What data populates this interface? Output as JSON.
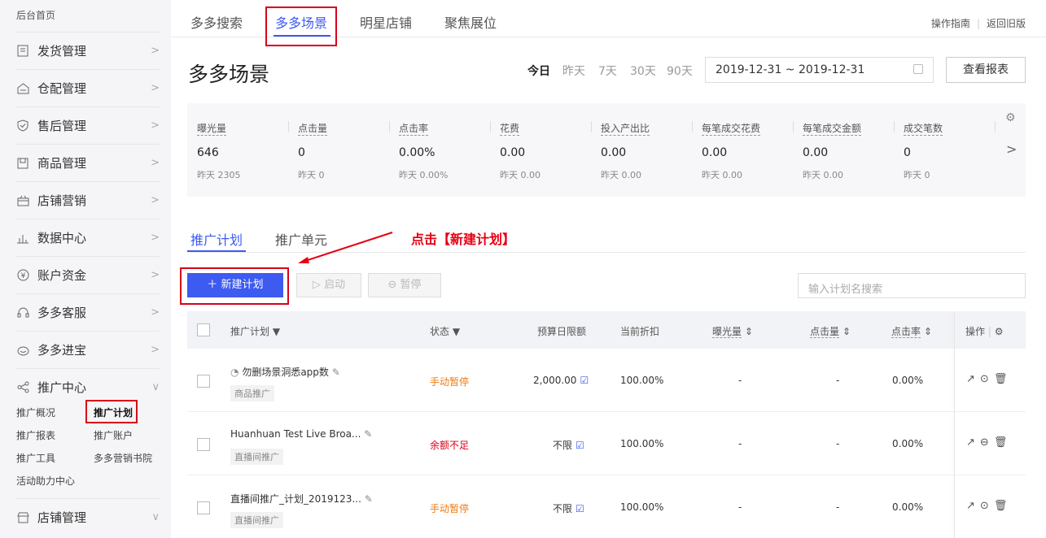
{
  "sidebar": {
    "home": "后台首页",
    "items": [
      {
        "label": "发货管理",
        "icon": "document-icon"
      },
      {
        "label": "仓配管理",
        "icon": "warehouse-icon"
      },
      {
        "label": "售后管理",
        "icon": "shield-check-icon"
      },
      {
        "label": "商品管理",
        "icon": "product-icon"
      },
      {
        "label": "店铺营销",
        "icon": "gift-icon"
      },
      {
        "label": "数据中心",
        "icon": "bar-chart-icon"
      },
      {
        "label": "账户资金",
        "icon": "yen-coin-icon"
      },
      {
        "label": "多多客服",
        "icon": "headset-icon"
      },
      {
        "label": "多多进宝",
        "icon": "treasure-icon"
      },
      {
        "label": "推广中心",
        "icon": "share-icon"
      },
      {
        "label": "店铺管理",
        "icon": "store-icon"
      }
    ],
    "promo_sub": [
      "推广概况",
      "推广计划",
      "推广报表",
      "推广账户",
      "推广工具",
      "多多营销书院",
      "活动助力中心"
    ]
  },
  "top_tabs": [
    "多多搜索",
    "多多场景",
    "明星店铺",
    "聚焦展位"
  ],
  "top_links": {
    "guide": "操作指南",
    "back": "返回旧版"
  },
  "page_title": "多多场景",
  "ranges": [
    "今日",
    "昨天",
    "7天",
    "30天",
    "90天"
  ],
  "date_range": "2019-12-31 ~ 2019-12-31",
  "report_button": "查看报表",
  "stats": [
    {
      "label": "曝光量",
      "value": "646",
      "yesterday": "昨天 2305"
    },
    {
      "label": "点击量",
      "value": "0",
      "yesterday": "昨天 0"
    },
    {
      "label": "点击率",
      "value": "0.00%",
      "yesterday": "昨天 0.00%"
    },
    {
      "label": "花费",
      "value": "0.00",
      "yesterday": "昨天 0.00"
    },
    {
      "label": "投入产出比",
      "value": "0.00",
      "yesterday": "昨天 0.00"
    },
    {
      "label": "每笔成交花费",
      "value": "0.00",
      "yesterday": "昨天 0.00"
    },
    {
      "label": "每笔成交金额",
      "value": "0.00",
      "yesterday": "昨天 0.00"
    },
    {
      "label": "成交笔数",
      "value": "0",
      "yesterday": "昨天 0"
    }
  ],
  "sub_tabs": [
    "推广计划",
    "推广单元"
  ],
  "annotation": "点击【新建计划】",
  "buttons": {
    "new_plan": "＋ 新建计划",
    "start": "启动",
    "pause": "暂停"
  },
  "search_placeholder": "输入计划名搜索",
  "table": {
    "headers": [
      "推广计划",
      "状态",
      "预算日限额",
      "当前折扣",
      "曝光量",
      "点击量",
      "点击率",
      "操作"
    ],
    "rows": [
      {
        "name": "勿删场景洞悉app数",
        "tag": "商品推广",
        "status": "手动暂停",
        "budget": "2,000.00",
        "discount": "100.00%",
        "exposure": "-",
        "clicks": "-",
        "ctr": "0.00%"
      },
      {
        "name": "Huanhuan Test Live Broa...",
        "tag": "直播间推广",
        "status": "余额不足",
        "budget": "不限",
        "discount": "100.00%",
        "exposure": "-",
        "clicks": "-",
        "ctr": "0.00%"
      },
      {
        "name": "直播间推广_计划_2019123...",
        "tag": "直播间推广",
        "status": "手动暂停",
        "budget": "不限",
        "discount": "100.00%",
        "exposure": "-",
        "clicks": "-",
        "ctr": "0.00%"
      }
    ]
  },
  "colors": {
    "primary": "#3d5af1",
    "highlight": "#d9001b",
    "paused": "#ef7b10"
  }
}
